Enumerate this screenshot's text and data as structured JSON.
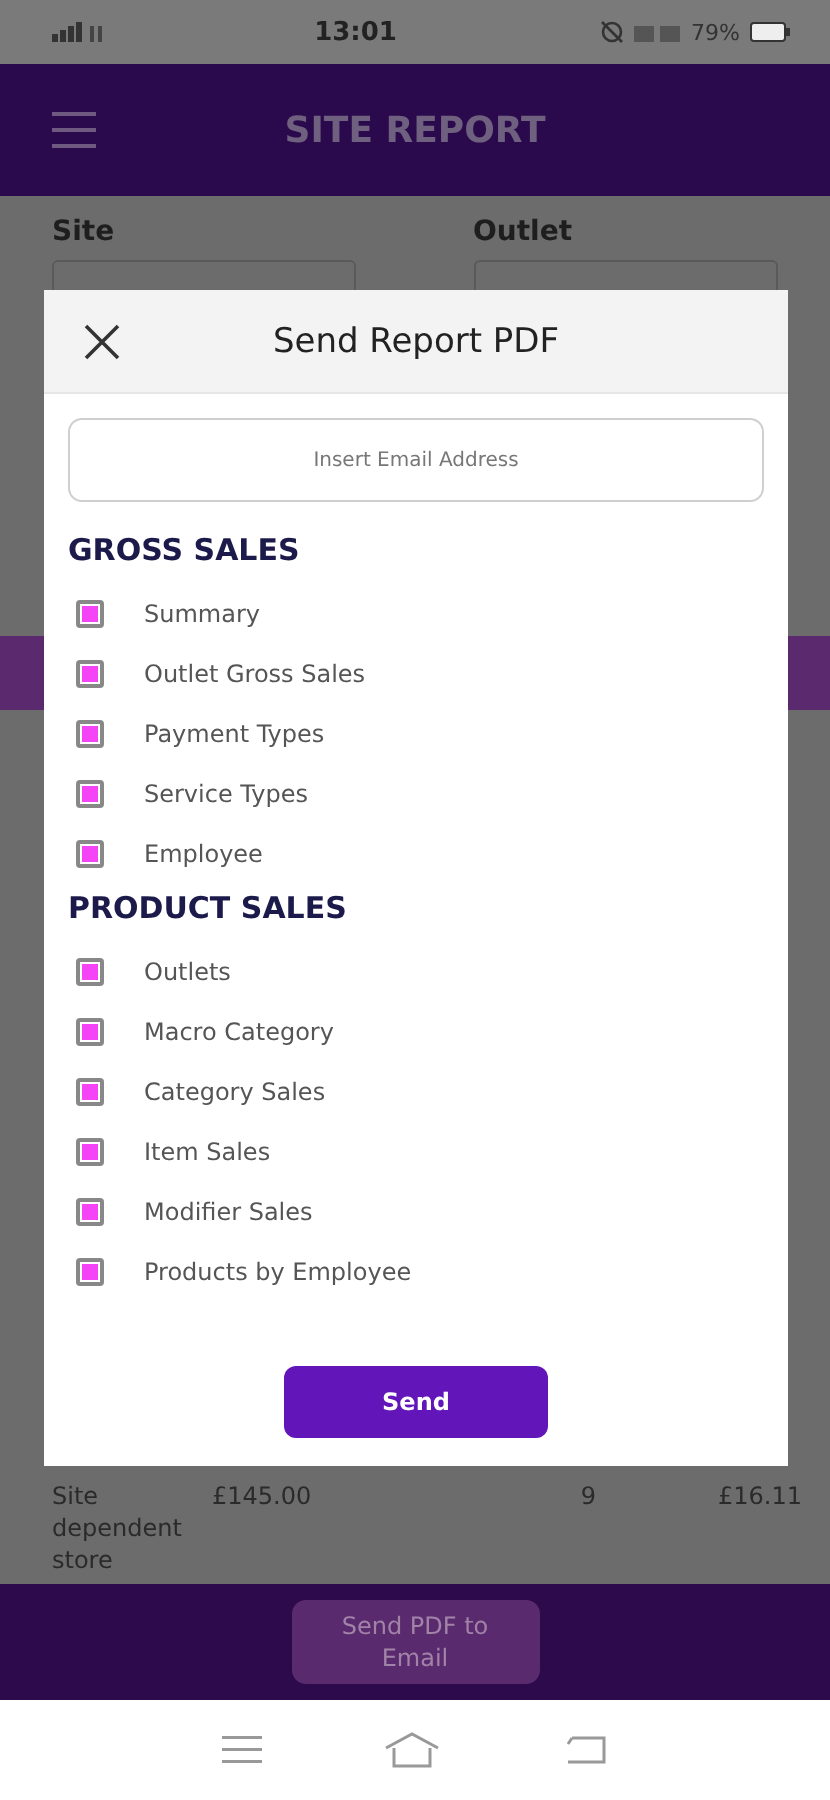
{
  "status_bar": {
    "time": "13:01",
    "battery": "79%"
  },
  "app_bar": {
    "title": "SITE REPORT"
  },
  "filters": [
    {
      "label": "Site"
    },
    {
      "label": "Outlet"
    }
  ],
  "table_row": {
    "name": "Site dependent store",
    "gross": "£145.00",
    "count": "9",
    "average": "£16.11"
  },
  "bottom_button": "Send PDF to Email",
  "dialog": {
    "title": "Send Report PDF",
    "email": {
      "placeholder": "Insert Email Address"
    },
    "sections": [
      {
        "heading": "GROSS SALES",
        "items": [
          {
            "label": "Summary",
            "checked": true
          },
          {
            "label": "Outlet Gross Sales",
            "checked": true
          },
          {
            "label": "Payment Types",
            "checked": true
          },
          {
            "label": "Service Types",
            "checked": true
          },
          {
            "label": "Employee",
            "checked": true
          }
        ]
      },
      {
        "heading": "PRODUCT SALES",
        "items": [
          {
            "label": "Outlets",
            "checked": true
          },
          {
            "label": "Macro Category",
            "checked": true
          },
          {
            "label": "Category Sales",
            "checked": true
          },
          {
            "label": "Item Sales",
            "checked": true
          },
          {
            "label": "Modifier Sales",
            "checked": true
          },
          {
            "label": "Products by Employee",
            "checked": true
          }
        ]
      }
    ],
    "send_button": "Send"
  }
}
